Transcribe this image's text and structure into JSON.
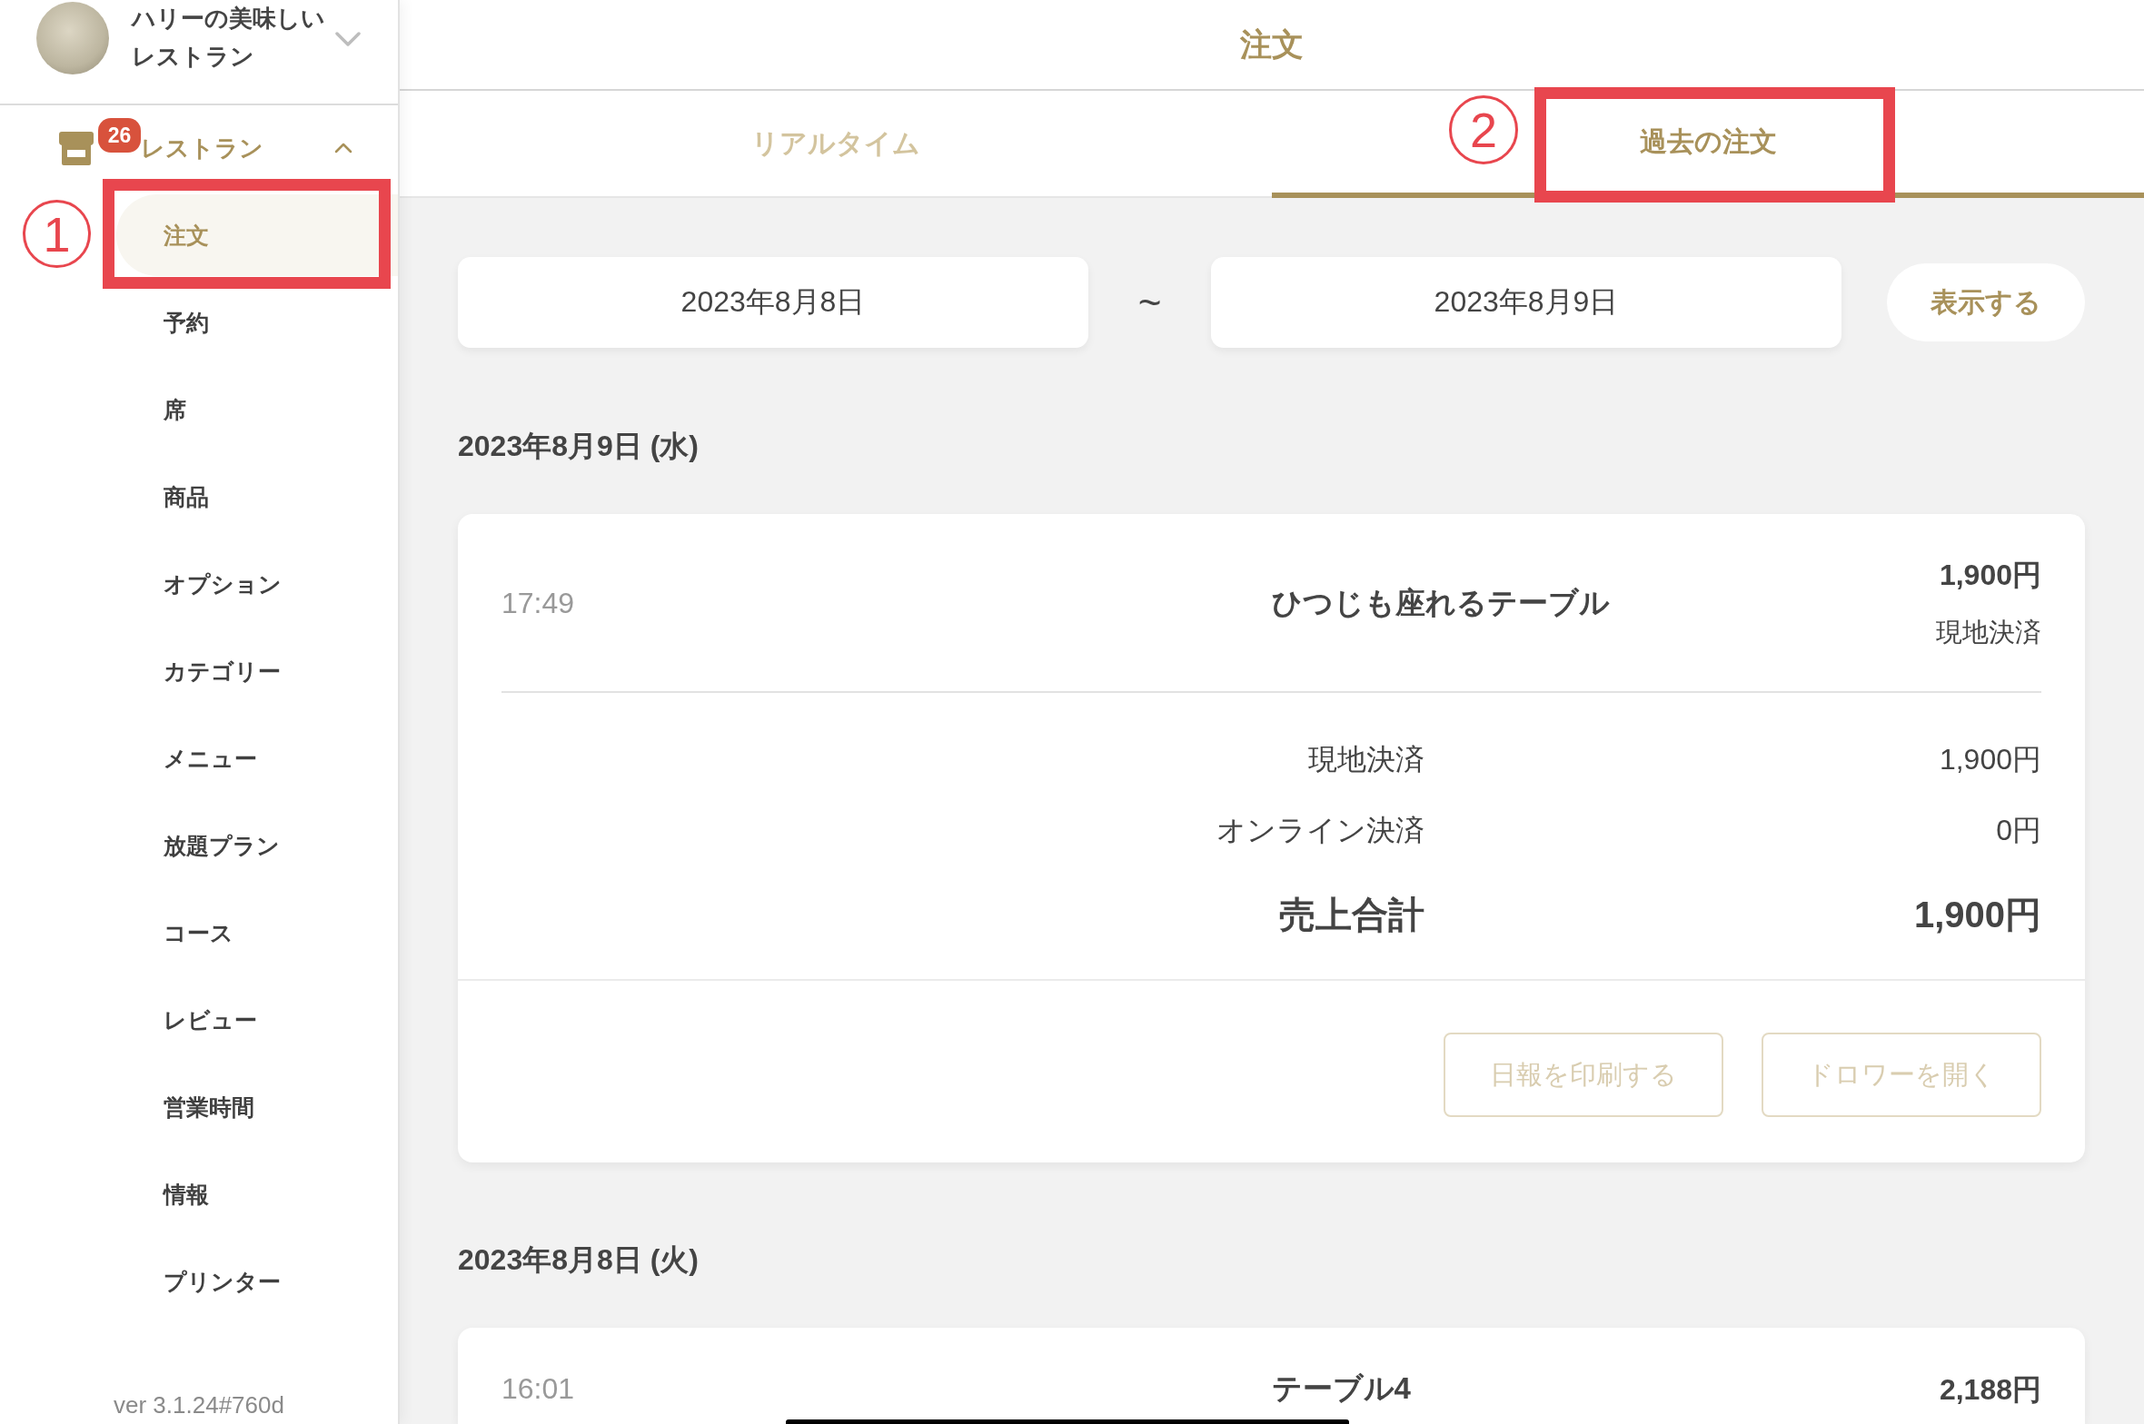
{
  "sidebar": {
    "restaurant_name": "ハリーの美味しいレストラン",
    "section": {
      "label": "レストラン",
      "badge": "26",
      "expanded": true,
      "items": [
        {
          "label": "注文",
          "selected": true,
          "annotation": "1"
        },
        {
          "label": "予約",
          "selected": false
        },
        {
          "label": "席",
          "selected": false
        },
        {
          "label": "商品",
          "selected": false
        },
        {
          "label": "オプション",
          "selected": false
        },
        {
          "label": "カテゴリー",
          "selected": false
        },
        {
          "label": "メニュー",
          "selected": false
        },
        {
          "label": "放題プラン",
          "selected": false
        },
        {
          "label": "コース",
          "selected": false
        },
        {
          "label": "レビュー",
          "selected": false
        },
        {
          "label": "営業時間",
          "selected": false
        },
        {
          "label": "情報",
          "selected": false
        },
        {
          "label": "プリンター",
          "selected": false
        }
      ]
    },
    "version": "ver 3.1.24#760d"
  },
  "header": {
    "title": "注文"
  },
  "tabs": [
    {
      "label": "リアルタイム",
      "selected": false
    },
    {
      "label": "過去の注文",
      "selected": true,
      "annotation": "2"
    }
  ],
  "date_range": {
    "from": "2023年8月8日",
    "separator": "~",
    "to": "2023年8月9日",
    "button": "表示する"
  },
  "days": [
    {
      "heading": "2023年8月9日 (水)",
      "orders": [
        {
          "time": "17:49",
          "table": "ひつじも座れるテーブル",
          "amount": "1,900円",
          "payment": "現地決済"
        }
      ],
      "summary": {
        "rows": [
          {
            "label": "現地決済",
            "value": "1,900円"
          },
          {
            "label": "オンライン決済",
            "value": "0円"
          }
        ],
        "total_label": "売上合計",
        "total_value": "1,900円"
      },
      "actions": [
        {
          "label": "日報を印刷する",
          "disabled": true
        },
        {
          "label": "ドロワーを開く",
          "disabled": true
        }
      ]
    },
    {
      "heading": "2023年8月8日 (火)",
      "orders": [
        {
          "time": "16:01",
          "table": "テーブル4",
          "amount": "2,188円"
        }
      ]
    }
  ]
}
